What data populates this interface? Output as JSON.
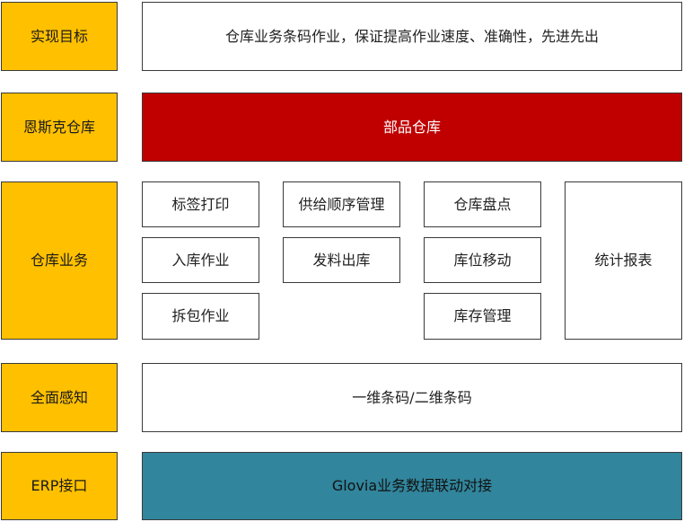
{
  "rows": {
    "goal": {
      "label": "实现目标",
      "content": "仓库业务条码作业，保证提高作业速度、准确性，先进先出"
    },
    "warehouse": {
      "label": "恩斯克仓库",
      "content": "部品仓库"
    },
    "operations": {
      "label": "仓库业务",
      "items": [
        "标签打印",
        "入库作业",
        "拆包作业",
        "供给顺序管理",
        "发料出库",
        "仓库盘点",
        "库位移动",
        "库存管理",
        "统计报表"
      ]
    },
    "perception": {
      "label": "全面感知",
      "content": "一维条码/二维条码"
    },
    "erp": {
      "label": "ERP接口",
      "content": "Glovia业务数据联动对接"
    }
  },
  "colors": {
    "label_fill": "#ffc000",
    "warehouse_fill": "#c00000",
    "erp_fill": "#31859c",
    "border": "#3a3a3a"
  }
}
